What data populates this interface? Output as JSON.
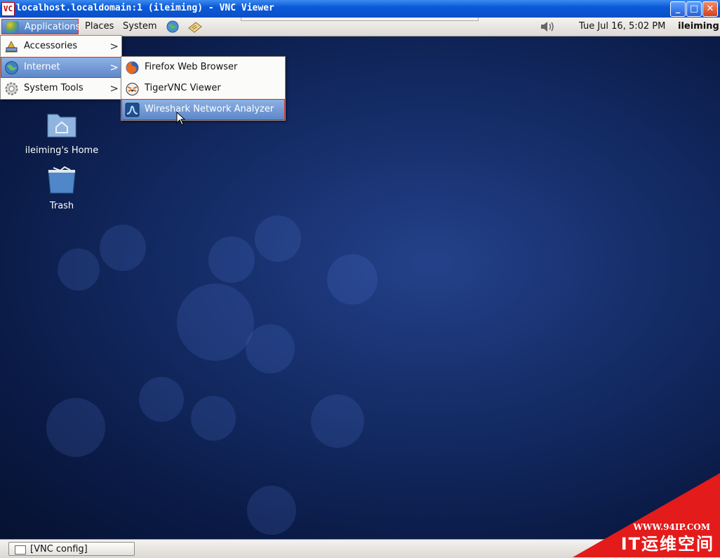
{
  "window": {
    "title": "localhost.localdomain:1 (ileiming) - VNC Viewer",
    "icon_label": "VC",
    "buttons": {
      "minimize": "_",
      "maximize": "□",
      "close": "✕"
    }
  },
  "panel": {
    "applications": "Applications",
    "places": "Places",
    "system": "System",
    "datetime": "Tue Jul 16,  5:02 PM",
    "user": "ileiming"
  },
  "apps_menu": {
    "items": [
      {
        "label": "Accessories",
        "icon": "accessories-icon"
      },
      {
        "label": "Internet",
        "icon": "internet-globe-icon"
      },
      {
        "label": "System Tools",
        "icon": "system-tools-gear-icon"
      }
    ],
    "arrow": ">"
  },
  "internet_menu": {
    "items": [
      {
        "label": "Firefox Web Browser",
        "icon": "firefox-icon"
      },
      {
        "label": "TigerVNC Viewer",
        "icon": "tigervnc-icon"
      },
      {
        "label": "Wireshark Network Analyzer",
        "icon": "wireshark-icon"
      }
    ]
  },
  "desktop": {
    "icons": [
      {
        "label": "ileiming's Home",
        "icon": "home-folder-icon"
      },
      {
        "label": "Trash",
        "icon": "trash-icon"
      }
    ]
  },
  "taskbar": {
    "task": "[VNC config]"
  },
  "watermark": {
    "url": "WWW.94IP.COM",
    "brand": "IT运维空间"
  },
  "colors": {
    "highlight": "#5d86c8",
    "titlebar": "#0a5ad8",
    "watermark": "#e31b1b"
  }
}
